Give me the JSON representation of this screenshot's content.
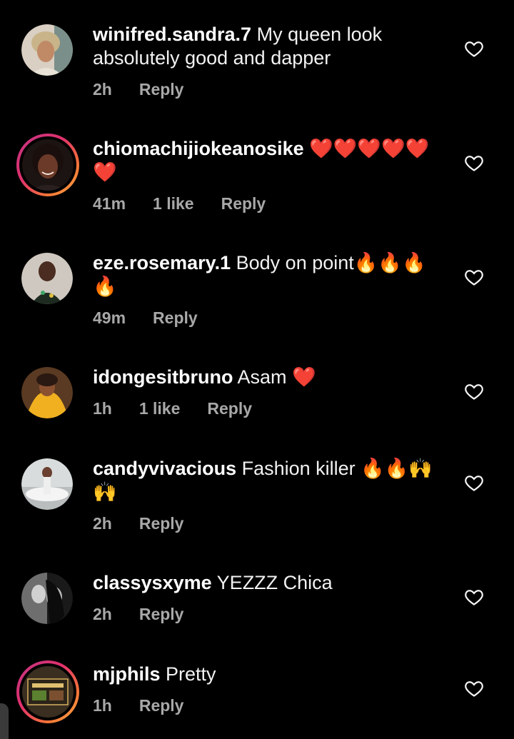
{
  "colors": {
    "background": "#000000",
    "username": "#ffffff",
    "comment_text": "#f2f2f2",
    "meta_text": "#a8a8a8",
    "story_ring": [
      "#c13584",
      "#e1306c",
      "#f77737",
      "#fcaf45"
    ]
  },
  "comments": [
    {
      "username": "winifred.sandra.7",
      "text": " My queen look absolutely good and dapper",
      "time": "2h",
      "likes": "",
      "reply_label": "Reply",
      "has_story_ring": false
    },
    {
      "username": "chiomachijiokeanosike",
      "text": " ❤️❤️❤️❤️❤️❤️",
      "time": "41m",
      "likes": "1 like",
      "reply_label": "Reply",
      "has_story_ring": true
    },
    {
      "username": "eze.rosemary.1",
      "text": " Body on point🔥🔥🔥🔥",
      "time": "49m",
      "likes": "",
      "reply_label": "Reply",
      "has_story_ring": false
    },
    {
      "username": "idongesitbruno",
      "text": " Asam ❤️",
      "time": "1h",
      "likes": "1 like",
      "reply_label": "Reply",
      "has_story_ring": false
    },
    {
      "username": "candyvivacious",
      "text": " Fashion killer 🔥🔥🙌🙌",
      "time": "2h",
      "likes": "",
      "reply_label": "Reply",
      "has_story_ring": false
    },
    {
      "username": "classysxyme",
      "text": " YEZZZ Chica",
      "time": "2h",
      "likes": "",
      "reply_label": "Reply",
      "has_story_ring": false
    },
    {
      "username": "mjphils",
      "text": " Pretty",
      "time": "1h",
      "likes": "",
      "reply_label": "Reply",
      "has_story_ring": true
    }
  ],
  "icons": {
    "like": "heart-outline-icon"
  }
}
